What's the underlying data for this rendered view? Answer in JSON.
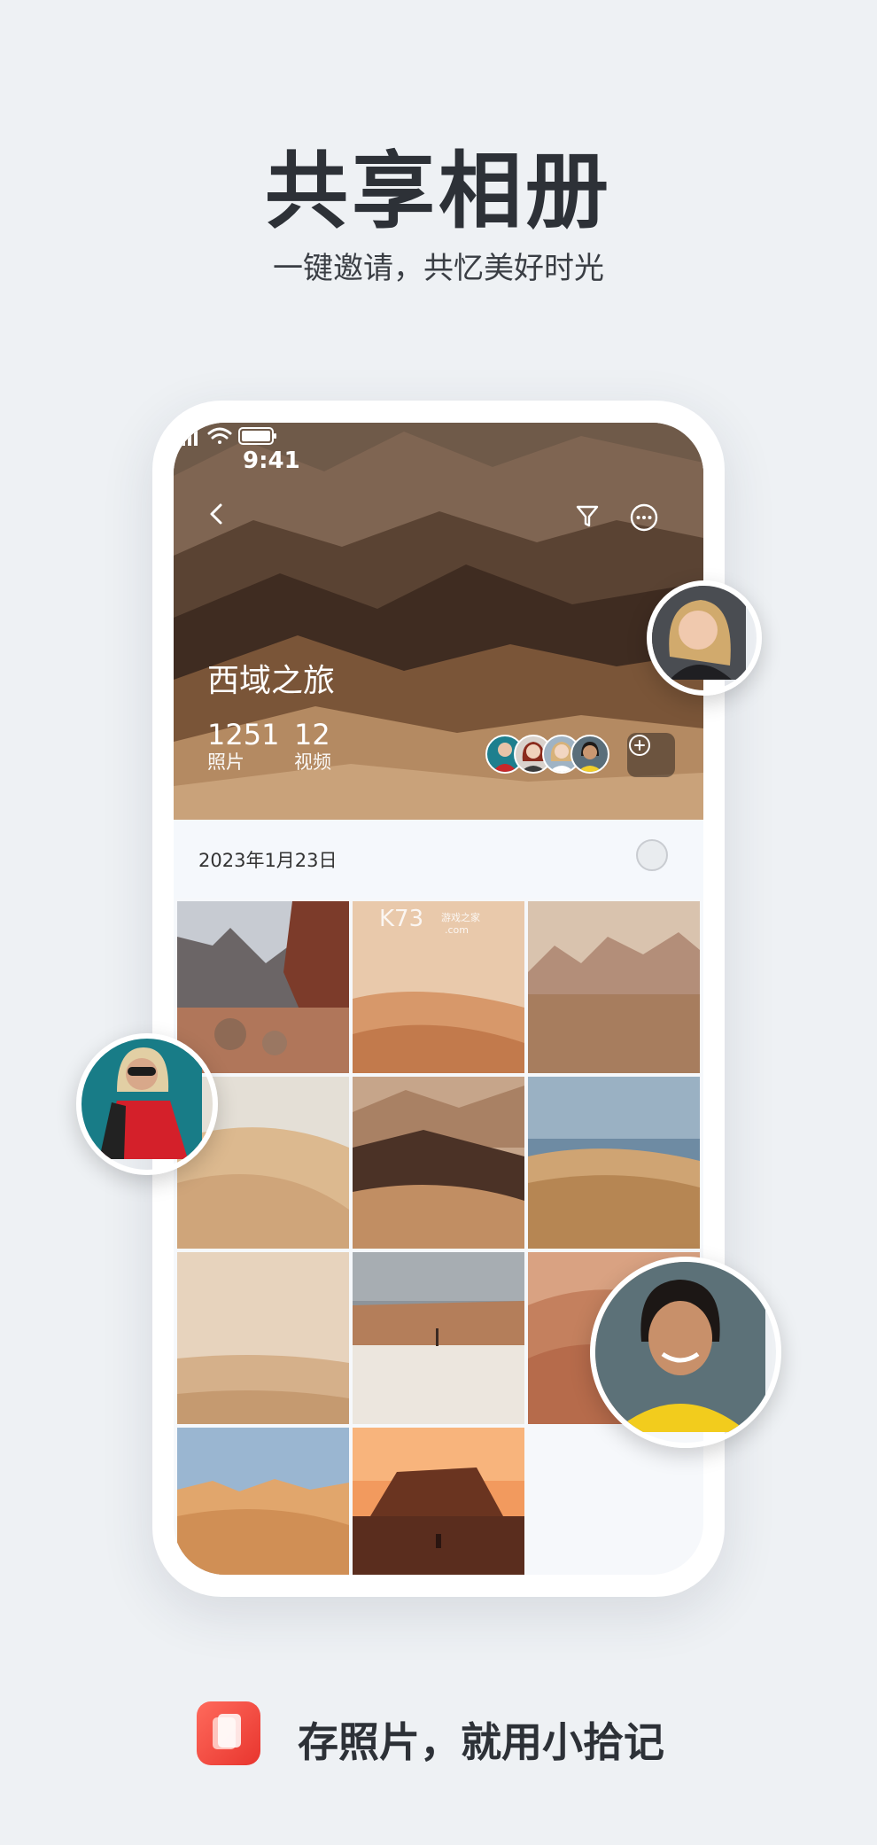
{
  "promo": {
    "headline": "共享相册",
    "subline": "一键邀请，共忆美好时光"
  },
  "status_bar": {
    "time": "9:41",
    "icons": [
      "signal-icon",
      "wifi-icon",
      "battery-icon"
    ]
  },
  "album": {
    "title": "西域之旅",
    "photos_count": "1251",
    "photos_label": "照片",
    "videos_count": "12",
    "videos_label": "视频",
    "member_count_shown": 4
  },
  "toolbar": {
    "back_icon": "chevron-left-icon",
    "filter_icon": "filter-icon",
    "more_icon": "more-icon",
    "add_member_icon": "plus-circle-icon"
  },
  "section": {
    "date": "2023年1月23日"
  },
  "grid": {
    "photo_count": 11
  },
  "watermark": {
    "logo": "K73",
    "sub": "游戏之家",
    "domain": ".com"
  },
  "footer": {
    "tagline": "存照片，就用小拾记"
  },
  "colors": {
    "page_bg": "#eef1f4",
    "brand_red": "#e8352e",
    "text_dark": "#2d3137"
  }
}
